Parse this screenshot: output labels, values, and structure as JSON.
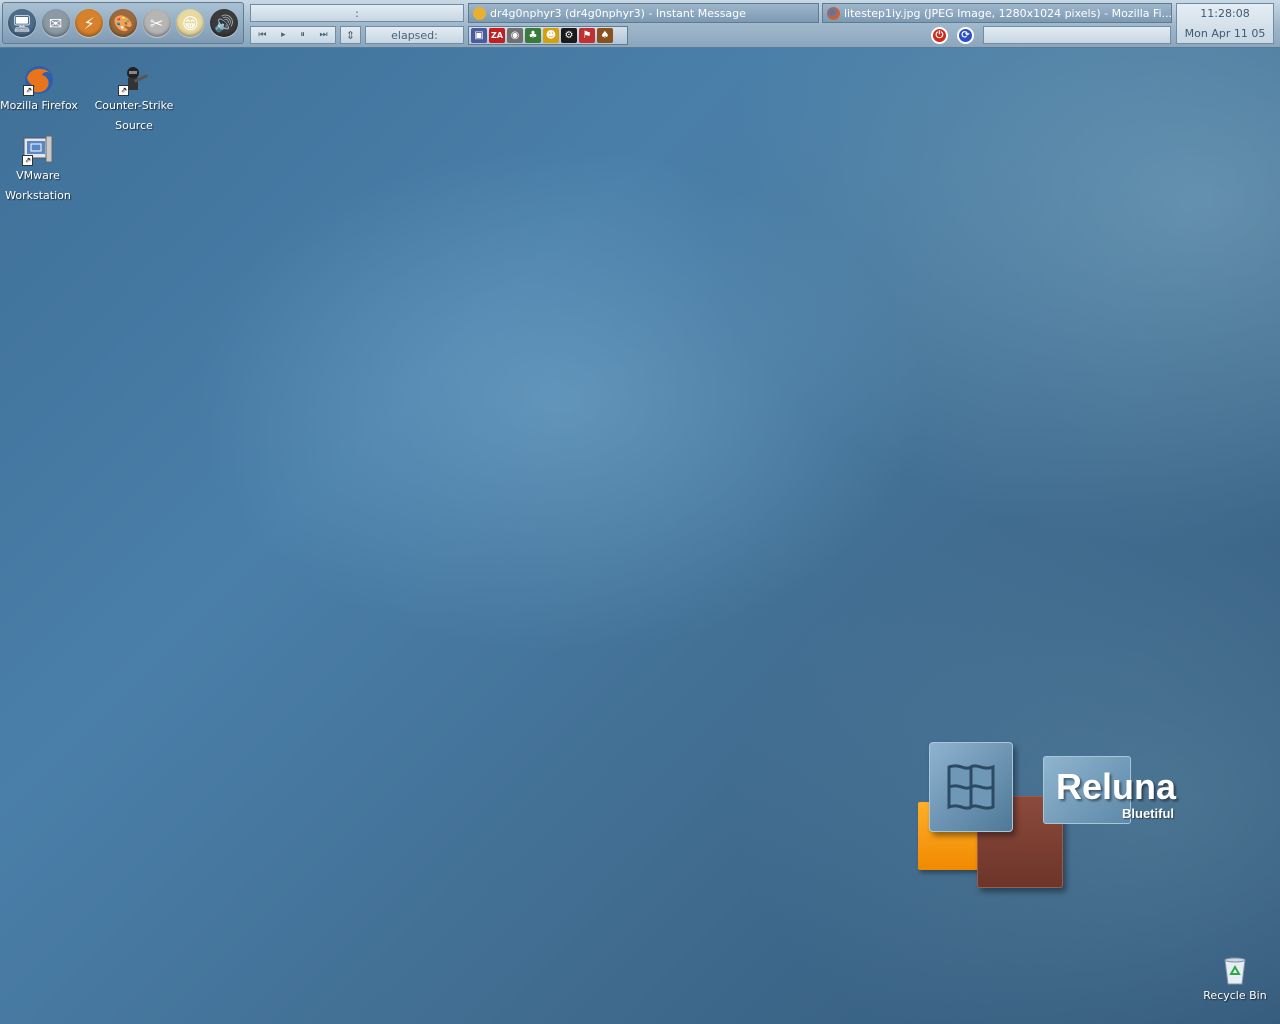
{
  "taskbar": {
    "quick_launch": [
      {
        "name": "my-computer-icon",
        "glyph": "🖥",
        "color": "#4c6c8a"
      },
      {
        "name": "mail-icon",
        "glyph": "✉",
        "color": "#8c9aa6"
      },
      {
        "name": "winamp-icon",
        "glyph": "⚡",
        "color": "#d6822c"
      },
      {
        "name": "palette-icon",
        "glyph": "🎨",
        "color": "#9c6a3c"
      },
      {
        "name": "tools-icon",
        "glyph": "✂",
        "color": "#b5b5b5"
      },
      {
        "name": "smiley-icon",
        "glyph": "😁",
        "color": "#e7d9a0"
      },
      {
        "name": "speaker-icon",
        "glyph": "🔊",
        "color": "#3b3b3b"
      }
    ],
    "player": {
      "track_display": ":",
      "elapsed_label": "elapsed:",
      "controls": [
        "⏮",
        "▸",
        "⏸",
        "⏭"
      ],
      "stop_glyph": "⇕"
    },
    "tasks": [
      {
        "label": "dr4g0nphyr3  (dr4g0nphyr3) - Instant Message",
        "icon_color": "#e8b030"
      },
      {
        "label": "litestep1iy.jpg (JPEG Image, 1280x1024 pixels) - Mozilla Fi...",
        "icon_color": "#e06020"
      }
    ],
    "tray_icons": [
      {
        "name": "vmware-tray-icon",
        "glyph": "▣",
        "color": "#4a5a9a"
      },
      {
        "name": "zonealarm-tray-icon",
        "glyph": "ZA",
        "color": "#c02020"
      },
      {
        "name": "disc-tray-icon",
        "glyph": "◉",
        "color": "#707070"
      },
      {
        "name": "network-tray-icon",
        "glyph": "♣",
        "color": "#3a7a3a"
      },
      {
        "name": "messenger-tray-icon",
        "glyph": "☻",
        "color": "#d4a010"
      },
      {
        "name": "steam-tray-icon",
        "glyph": "⚙",
        "color": "#1a1a1a"
      },
      {
        "name": "runner-tray-icon",
        "glyph": "⚑",
        "color": "#c03030"
      },
      {
        "name": "cards-tray-icon",
        "glyph": "♠",
        "color": "#8a5020"
      }
    ],
    "clock": {
      "time": "11:28:08",
      "date": "Mon Apr 11 05"
    },
    "buttons": {
      "power": "⏻",
      "refresh": "⟳"
    }
  },
  "desktop_icons": [
    {
      "label": "Mozilla Firefox"
    },
    {
      "label": "Counter-Strike Source"
    },
    {
      "label": "VMware Workstation"
    },
    {
      "label": "Recycle Bin"
    }
  ],
  "logo": {
    "title": "Reluna",
    "subtitle": "Bluetiful"
  }
}
